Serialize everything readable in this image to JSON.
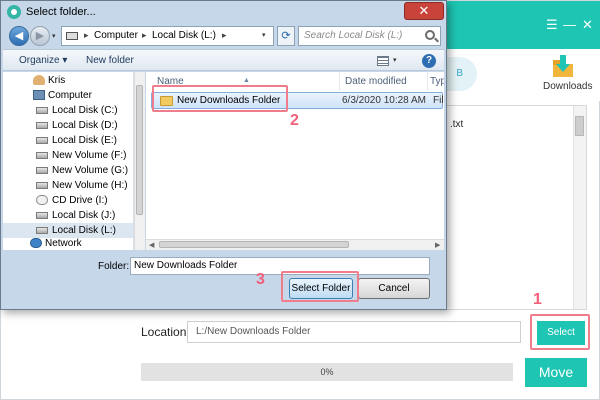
{
  "app": {
    "pill_text": "B",
    "downloads_label": "Downloads",
    "list_fragment": ".txt",
    "location_label": "Location:",
    "location_value": "L:/New Downloads Folder",
    "select_label": "Select",
    "progress_text": "0%",
    "move_label": "Move",
    "window_controls": {
      "menu": "☰",
      "minimize": "—",
      "close": "✕"
    },
    "accent_color": "#1ec5b2"
  },
  "dialog": {
    "title": "Select folder...",
    "close_glyph": "✕",
    "nav": {
      "back": "◀",
      "forward": "▶",
      "dropdown": "▾",
      "refresh": "⟳"
    },
    "breadcrumb": [
      "Computer",
      "Local Disk (L:)"
    ],
    "crumb_sep": "▸",
    "search_placeholder": "Search Local Disk (L:)",
    "commands": {
      "organize": "Organize ▾",
      "new_folder": "New folder"
    },
    "help_glyph": "?",
    "tree": [
      {
        "label": "Kris",
        "icon": "user-icon"
      },
      {
        "label": "Computer",
        "icon": "computer-icon"
      },
      {
        "label": "Local Disk (C:)",
        "icon": "drive-icon"
      },
      {
        "label": "Local Disk (D:)",
        "icon": "drive-icon"
      },
      {
        "label": "Local Disk (E:)",
        "icon": "drive-icon"
      },
      {
        "label": "New Volume (F:)",
        "icon": "drive-icon"
      },
      {
        "label": "New Volume (G:)",
        "icon": "drive-icon"
      },
      {
        "label": "New Volume (H:)",
        "icon": "drive-icon"
      },
      {
        "label": "CD Drive (I:)",
        "icon": "cd-drive-icon"
      },
      {
        "label": "Local Disk (J:)",
        "icon": "drive-icon"
      },
      {
        "label": "Local Disk (L:)",
        "icon": "drive-icon",
        "selected": true
      },
      {
        "label": "Network",
        "icon": "network-icon"
      }
    ],
    "columns": [
      "Name",
      "Date modified",
      "Typ"
    ],
    "rows": [
      {
        "name": "New Downloads Folder",
        "date": "6/3/2020 10:28 AM",
        "type": "File"
      }
    ],
    "folder_label": "Folder:",
    "folder_value": "New Downloads Folder",
    "select_folder_label": "Select Folder",
    "cancel_label": "Cancel"
  },
  "annotations": {
    "step1": "1",
    "step2": "2",
    "step3": "3",
    "color": "#f07d8c"
  }
}
